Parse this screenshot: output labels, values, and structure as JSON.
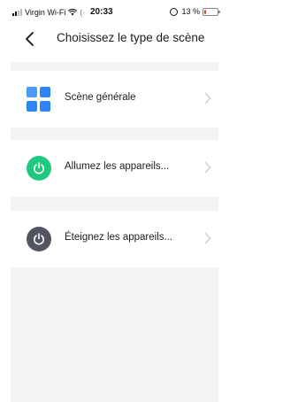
{
  "status_bar": {
    "carrier": "Virgin Wi-Fi",
    "location_glyph": "(·",
    "time": "20:33",
    "battery_text": "13 %",
    "battery_level": 0.13,
    "battery_color": "#e8453c"
  },
  "nav": {
    "title": "Choisissez le type de scène",
    "back_icon": "chevron-left-icon"
  },
  "scene_types": [
    {
      "label": "Scène générale",
      "icon": "grid-icon",
      "color": "#2e86f5"
    },
    {
      "label": "Allumez les appareils...",
      "icon": "power-icon",
      "color": "#1fc980"
    },
    {
      "label": "Éteignez les appareils...",
      "icon": "power-icon",
      "color": "#52555f"
    }
  ]
}
